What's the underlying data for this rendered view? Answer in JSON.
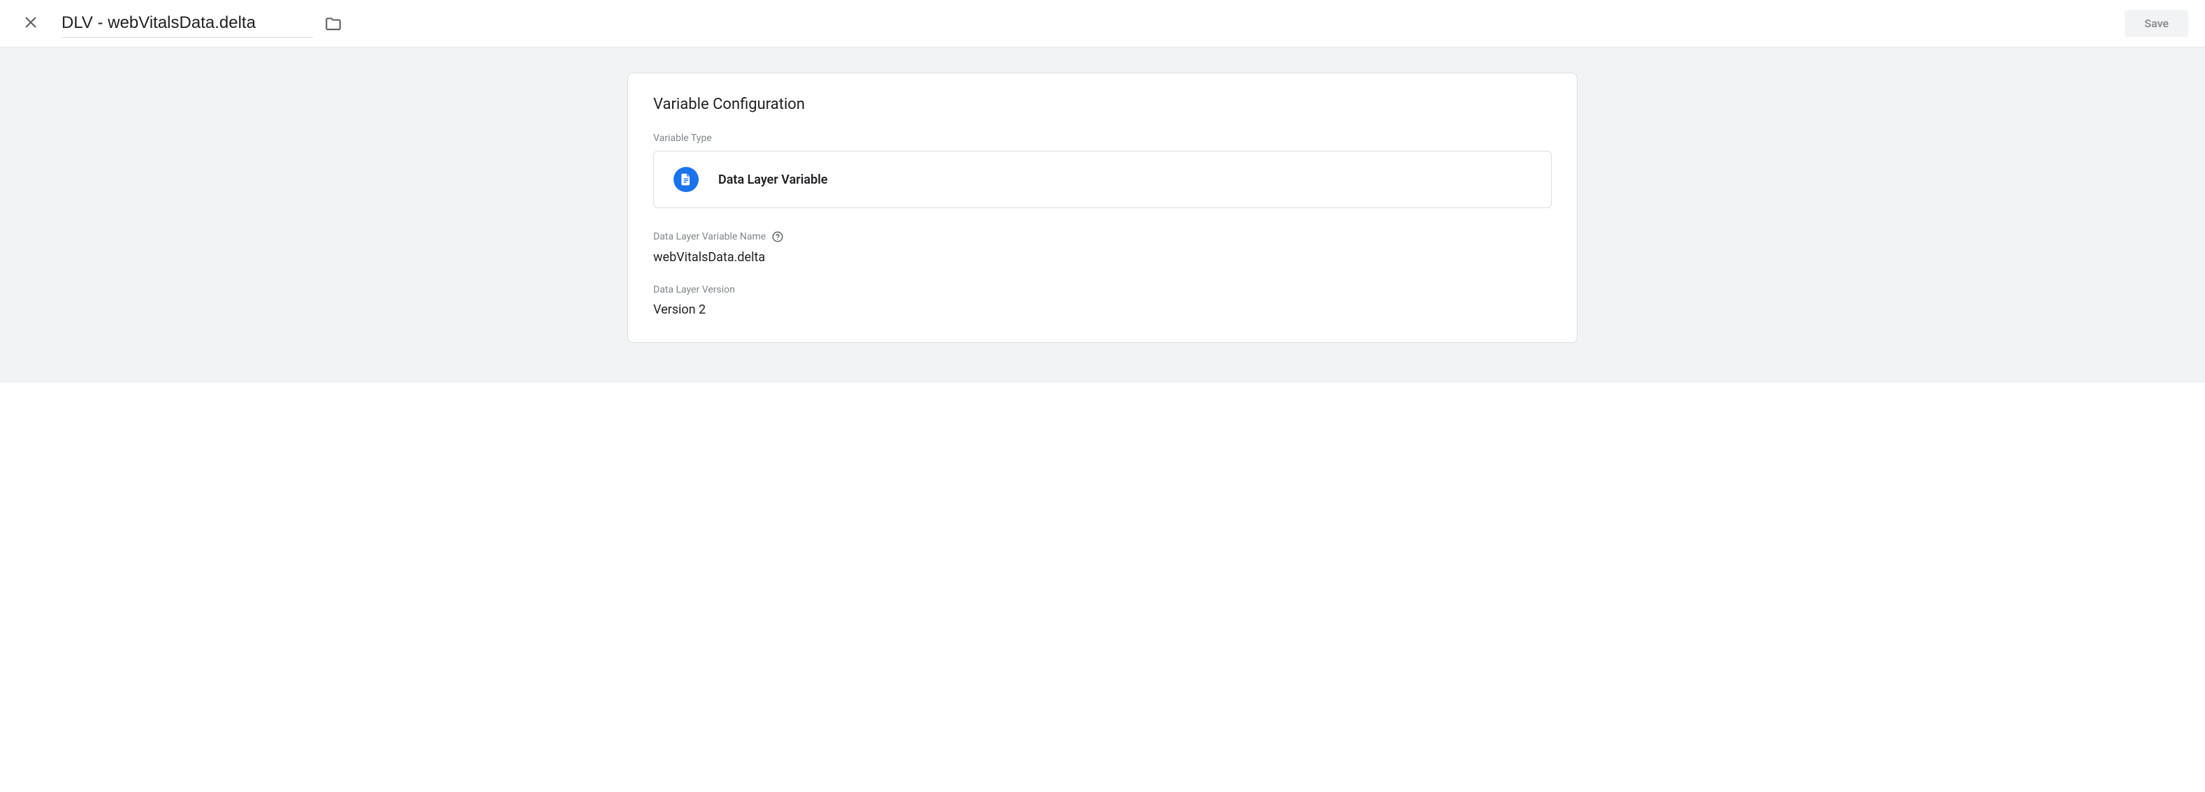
{
  "header": {
    "title": "DLV - webVitalsData.delta",
    "save_label": "Save"
  },
  "config": {
    "card_title": "Variable Configuration",
    "type_label": "Variable Type",
    "type_name": "Data Layer Variable",
    "name_label": "Data Layer Variable Name",
    "name_value": "webVitalsData.delta",
    "version_label": "Data Layer Version",
    "version_value": "Version 2"
  }
}
